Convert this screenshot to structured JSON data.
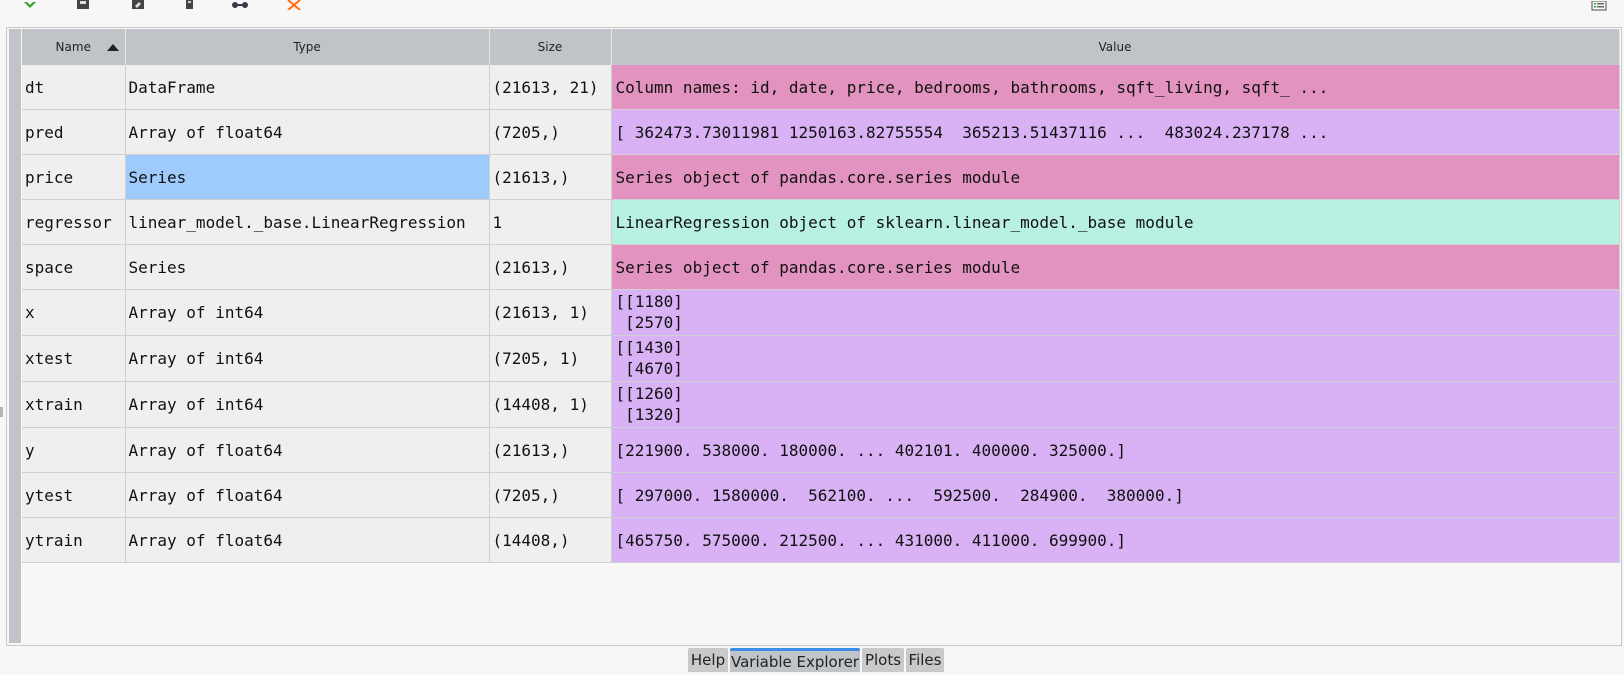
{
  "toolbar": {
    "icons": [
      "import-data-icon",
      "save-data-icon",
      "save-as-icon",
      "copy-icon",
      "link-icon",
      "remove-all-icon",
      "options-menu-icon"
    ],
    "colors": {
      "import": "#2aa52a",
      "remove": "#ff6a13",
      "neutral": "#444444"
    }
  },
  "table": {
    "columns": {
      "name": "Name",
      "type": "Type",
      "size": "Size",
      "value": "Value"
    },
    "sorted_by": "Name",
    "sort_direction": "ascending",
    "rows": [
      {
        "name": "dt",
        "type": "DataFrame",
        "size": "(21613, 21)",
        "value": "Column names: id, date, price, bedrooms, bathrooms, sqft_living, sqft_ ...",
        "color": "#e393bf"
      },
      {
        "name": "pred",
        "type": "Array of float64",
        "size": "(7205,)",
        "value": "[ 362473.73011981 1250163.82755554  365213.51437116 ...  483024.237178 ...",
        "color": "#d9b1f5"
      },
      {
        "name": "price",
        "type": "Series",
        "size": "(21613,)",
        "value": "Series object of pandas.core.series module",
        "color": "#e393bf",
        "selected": true
      },
      {
        "name": "regressor",
        "type": "linear_model._base.LinearRegression",
        "size": "1",
        "value": "LinearRegression object of sklearn.linear_model._base module",
        "color": "#b8f0e2"
      },
      {
        "name": "space",
        "type": "Series",
        "size": "(21613,)",
        "value": "Series object of pandas.core.series module",
        "color": "#e393bf"
      },
      {
        "name": "x",
        "type": "Array of int64",
        "size": "(21613, 1)",
        "value": "[[1180]\n [2570]",
        "color": "#d9b1f5",
        "multiline": true
      },
      {
        "name": "xtest",
        "type": "Array of int64",
        "size": "(7205, 1)",
        "value": "[[1430]\n [4670]",
        "color": "#d9b1f5",
        "multiline": true
      },
      {
        "name": "xtrain",
        "type": "Array of int64",
        "size": "(14408, 1)",
        "value": "[[1260]\n [1320]",
        "color": "#d9b1f5",
        "multiline": true
      },
      {
        "name": "y",
        "type": "Array of float64",
        "size": "(21613,)",
        "value": "[221900. 538000. 180000. ... 402101. 400000. 325000.]",
        "color": "#d9b1f5"
      },
      {
        "name": "ytest",
        "type": "Array of float64",
        "size": "(7205,)",
        "value": "[ 297000. 1580000.  562100. ...  592500.  284900.  380000.]",
        "color": "#d9b1f5"
      },
      {
        "name": "ytrain",
        "type": "Array of float64",
        "size": "(14408,)",
        "value": "[465750. 575000. 212500. ... 431000. 411000. 699900.]",
        "color": "#d9b1f5"
      }
    ]
  },
  "tabs": [
    {
      "label": "Help",
      "active": false
    },
    {
      "label": "Variable Explorer",
      "active": true
    },
    {
      "label": "Plots",
      "active": false
    },
    {
      "label": "Files",
      "active": false
    }
  ],
  "colors": {
    "selection": "#9fcbfc",
    "header_bg": "#c0c4c9",
    "tab_active_accent": "#3a8ee6"
  }
}
